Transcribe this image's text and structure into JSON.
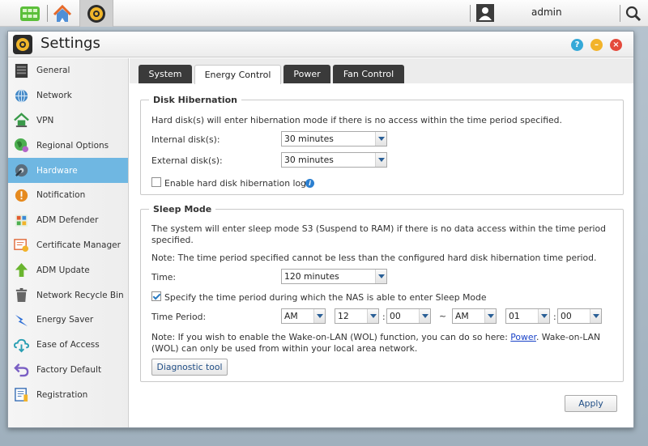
{
  "taskbar": {
    "apps": [
      {
        "name": "desktop-app",
        "icon": "grid-icon"
      },
      {
        "name": "home-app",
        "icon": "home-icon"
      },
      {
        "name": "settings-app",
        "icon": "settings-gear-icon",
        "active": true
      }
    ],
    "user": "admin"
  },
  "window": {
    "title": "Settings",
    "controls": [
      "help",
      "minimize",
      "close"
    ],
    "colors": {
      "help": "#35a9d8",
      "minimize": "#f2b32a",
      "close": "#e44a3c",
      "accent": "#6fb7e2"
    }
  },
  "sidebar": {
    "items": [
      {
        "label": "General",
        "icon": "general-icon"
      },
      {
        "label": "Network",
        "icon": "network-icon"
      },
      {
        "label": "VPN",
        "icon": "vpn-icon"
      },
      {
        "label": "Regional Options",
        "icon": "regional-options-icon"
      },
      {
        "label": "Hardware",
        "icon": "hardware-icon",
        "active": true
      },
      {
        "label": "Notification",
        "icon": "notification-icon"
      },
      {
        "label": "ADM Defender",
        "icon": "adm-defender-icon"
      },
      {
        "label": "Certificate Manager",
        "icon": "certificate-icon"
      },
      {
        "label": "ADM Update",
        "icon": "adm-update-icon"
      },
      {
        "label": "Network Recycle Bin",
        "icon": "recycle-bin-icon"
      },
      {
        "label": "Energy Saver",
        "icon": "energy-saver-icon"
      },
      {
        "label": "Ease of Access",
        "icon": "ease-of-access-icon"
      },
      {
        "label": "Factory Default",
        "icon": "factory-default-icon"
      },
      {
        "label": "Registration",
        "icon": "registration-icon"
      }
    ]
  },
  "tabs": [
    {
      "label": "System"
    },
    {
      "label": "Energy Control",
      "active": true
    },
    {
      "label": "Power"
    },
    {
      "label": "Fan Control"
    }
  ],
  "disk_hibernation": {
    "title": "Disk Hibernation",
    "description": "Hard disk(s) will enter hibernation mode if there is no access within the time period specified.",
    "internal_label": "Internal disk(s):",
    "internal_value": "30 minutes",
    "external_label": "External disk(s):",
    "external_value": "30 minutes",
    "log_label": "Enable hard disk hibernation log",
    "log_checked": false
  },
  "sleep_mode": {
    "title": "Sleep Mode",
    "description_line1": "The system will enter sleep mode S3 (Suspend to RAM) if there is no data access within the time period",
    "description_line2": "specified.",
    "note": "Note: The time period specified cannot be less than the configured hard disk hibernation time period.",
    "time_label": "Time:",
    "time_value": "120 minutes",
    "specify_label": "Specify the time period during which the NAS is able to enter Sleep Mode",
    "specify_checked": true,
    "period_label": "Time Period:",
    "start_ampm": "AM",
    "start_hour": "12",
    "start_minute": "00",
    "range_separator": "~",
    "end_ampm": "AM",
    "end_hour": "01",
    "end_minute": "00",
    "colon": ":",
    "wol_note_prefix": "Note: If you wish to enable the Wake-on-LAN (WOL) function, you can do so here: ",
    "wol_link": "Power",
    "wol_note_suffix": ". Wake-on-LAN",
    "wol_note_line2": "(WOL) can only be used from within your local area network.",
    "diagnostic_button": "Diagnostic tool"
  },
  "footer": {
    "apply_button": "Apply"
  }
}
